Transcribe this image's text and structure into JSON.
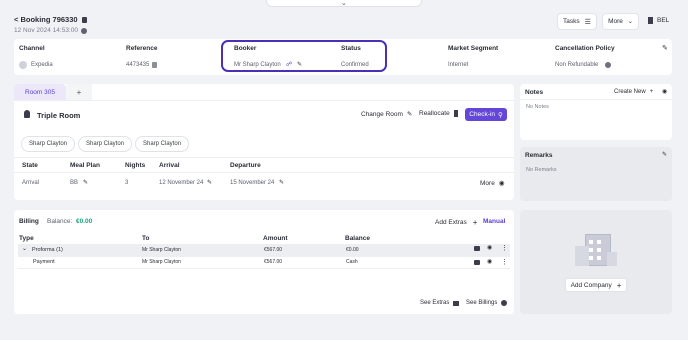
{
  "header": {
    "back_label": "< Booking 796330",
    "datetime": "12 Nov 2024 14:53:00",
    "tasks_label": "Tasks",
    "more_label": "More",
    "lang": "BEL"
  },
  "summary": {
    "columns": [
      "Channel",
      "Reference",
      "Booker",
      "Status",
      "Market Segment",
      "Cancellation Policy"
    ],
    "channel": "Expedia",
    "reference": "4473435",
    "booker": "Mr Sharp Clayton",
    "status": "Confirmed",
    "market_segment": "Internet",
    "cancellation_policy": "Non Refundable"
  },
  "room": {
    "tab_label": "Room 305",
    "tab_add": "+",
    "room_type": "Triple Room",
    "change_room": "Change Room",
    "reallocate": "Reallocate",
    "checkin": "Check-in",
    "guests": [
      "Sharp Clayton",
      "Sharp Clayton",
      "Sharp Clayton"
    ],
    "stay_headers": [
      "State",
      "Meal Plan",
      "Nights",
      "Arrival",
      "Departure"
    ],
    "stay": {
      "state": "Arrival",
      "meal_plan": "BB",
      "nights": "3",
      "arrival": "12 November 24",
      "departure": "15 November 24",
      "more": "More"
    }
  },
  "billing": {
    "title": "Billing",
    "balance_label": "Balance:",
    "balance_value": "€0.00",
    "add_extras": "Add Extras",
    "manual": "Manual",
    "headers": [
      "Type",
      "To",
      "Amount",
      "Balance"
    ],
    "rows": [
      {
        "type": "Proforma (1)",
        "to": "Mr Sharp Clayton",
        "amount": "€567.00",
        "balance": "€0.00"
      },
      {
        "type": "Payment",
        "to": "Mr Sharp Clayton",
        "amount": "€567.00",
        "balance": "Cash"
      }
    ],
    "see_extras": "See Extras",
    "see_billings": "See Billings"
  },
  "notes": {
    "title": "Notes",
    "create_new": "Create New",
    "empty": "No Notes"
  },
  "remarks": {
    "title": "Remarks",
    "empty": "No Remarks"
  },
  "company": {
    "add_label": "Add Company"
  },
  "colors": {
    "accent": "#5b3fcf",
    "balance_green": "#1aa37a",
    "highlight_border": "#4b2fb5"
  }
}
